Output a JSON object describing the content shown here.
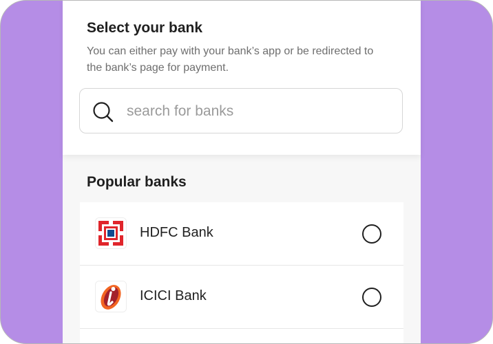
{
  "header": {
    "title": "Select your bank",
    "subtitle": "You can either pay with your bank’s app or be redirected to the bank’s page for payment."
  },
  "search": {
    "placeholder": "search for banks",
    "value": "",
    "icon": "search-icon"
  },
  "popular": {
    "title": "Popular banks",
    "banks": [
      {
        "name": "HDFC Bank",
        "logo": "hdfc-logo-icon",
        "selected": false
      },
      {
        "name": "ICICI Bank",
        "logo": "icici-logo-icon",
        "selected": false
      }
    ]
  },
  "colors": {
    "background_accent": "#b58de6",
    "hdfc_red": "#e0252b",
    "hdfc_blue": "#114a8f",
    "icici_orange": "#f26522",
    "icici_maroon": "#a3212b"
  }
}
